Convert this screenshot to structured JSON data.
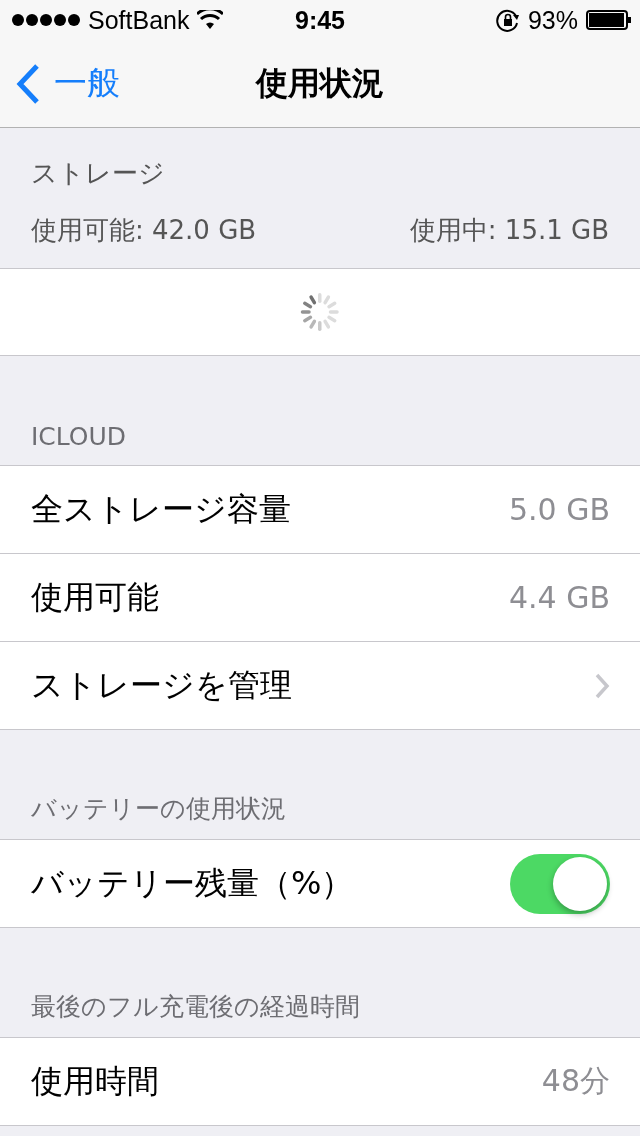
{
  "status_bar": {
    "carrier": "SoftBank",
    "time": "9:45",
    "battery": "93%"
  },
  "nav_bar": {
    "back": "一般",
    "title": "使用状況"
  },
  "storage": {
    "header": "ストレージ",
    "available": "使用可能: 42.0 GB",
    "used": "使用中: 15.1 GB",
    "loading": true
  },
  "sections": [
    {
      "header": "ICLOUD",
      "rows": [
        {
          "kind": "value",
          "label": "全ストレージ容量",
          "value": "5.0 GB"
        },
        {
          "kind": "value",
          "label": "使用可能",
          "value": "4.4 GB"
        },
        {
          "kind": "disclosure",
          "label": "ストレージを管理"
        }
      ]
    },
    {
      "header": "バッテリーの使用状況",
      "rows": [
        {
          "kind": "toggle",
          "label": "バッテリー残量（%）",
          "on": true
        }
      ]
    },
    {
      "header": "最後のフル充電後の経過時間",
      "rows": [
        {
          "kind": "value",
          "label": "使用時間",
          "value": "48分"
        }
      ]
    }
  ]
}
